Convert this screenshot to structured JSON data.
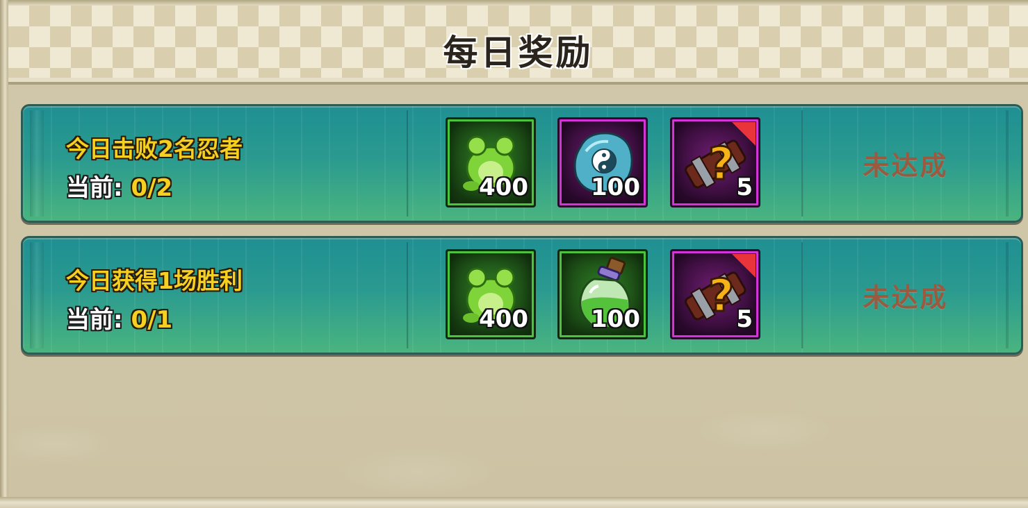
{
  "header": {
    "title": "每日奖励"
  },
  "quests": [
    {
      "title": "今日击败2名忍者",
      "progress_label": "当前:",
      "progress_value": "0/2",
      "status": "未达成",
      "rewards": [
        {
          "icon": "green-frog-icon",
          "rarity": "green",
          "quantity": "400"
        },
        {
          "icon": "yin-yang-stone-icon",
          "rarity": "purple",
          "quantity": "100"
        },
        {
          "icon": "mystery-scroll-icon",
          "rarity": "purple",
          "quantity": "5"
        }
      ]
    },
    {
      "title": "今日获得1场胜利",
      "progress_label": "当前:",
      "progress_value": "0/1",
      "status": "未达成",
      "rewards": [
        {
          "icon": "green-frog-icon",
          "rarity": "green",
          "quantity": "400"
        },
        {
          "icon": "green-potion-icon",
          "rarity": "green",
          "quantity": "100"
        },
        {
          "icon": "mystery-scroll-icon",
          "rarity": "purple",
          "quantity": "5"
        }
      ]
    }
  ],
  "colors": {
    "quest_title": "#f5d020",
    "status_incomplete": "#9a5a40",
    "green_rarity": "#4cc23d",
    "purple_rarity": "#d334d8"
  }
}
